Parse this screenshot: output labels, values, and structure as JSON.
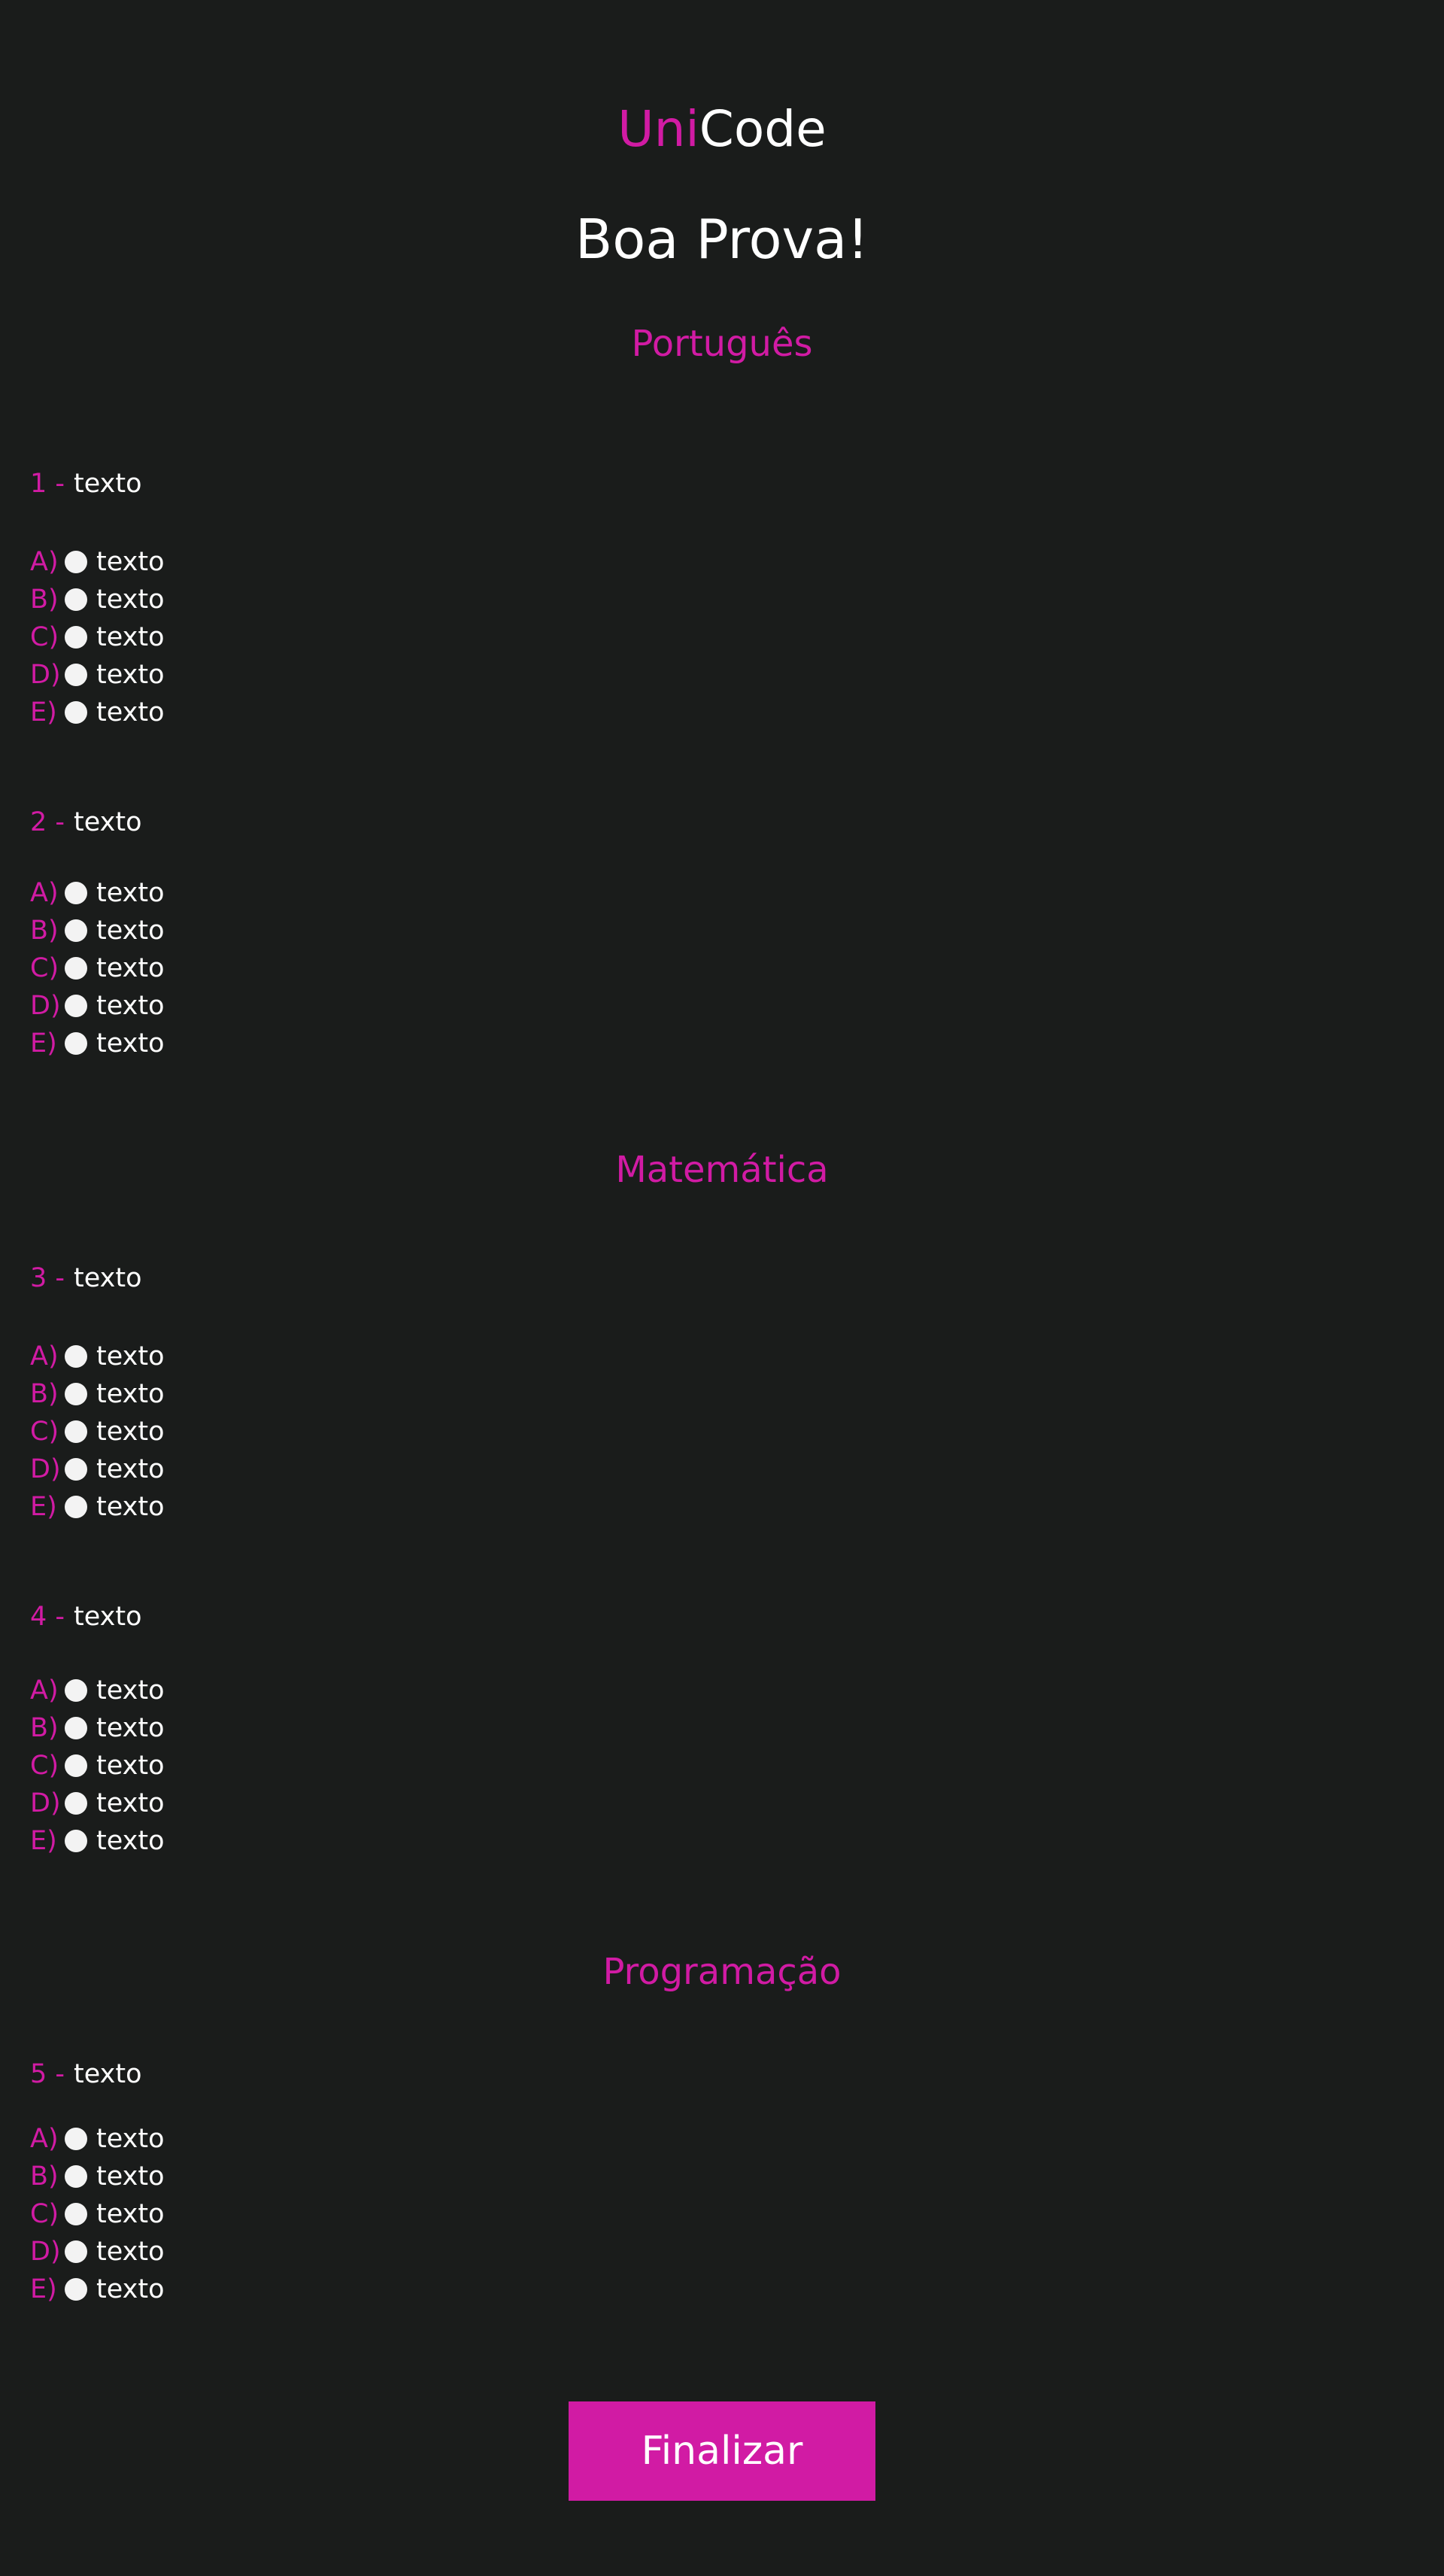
{
  "header": {
    "logo_part1": "Uni",
    "logo_part2": "Code",
    "title": "Boa Prova!"
  },
  "sections": [
    {
      "title": "Português"
    },
    {
      "title": "Matemática"
    },
    {
      "title": "Programação"
    }
  ],
  "questions": [
    {
      "number": "1 -",
      "text": "texto",
      "options": [
        {
          "letter": "A)",
          "text": "texto"
        },
        {
          "letter": "B)",
          "text": "texto"
        },
        {
          "letter": "C)",
          "text": "texto"
        },
        {
          "letter": "D)",
          "text": "texto"
        },
        {
          "letter": "E)",
          "text": "texto"
        }
      ]
    },
    {
      "number": "2 -",
      "text": "texto",
      "options": [
        {
          "letter": "A)",
          "text": "texto"
        },
        {
          "letter": "B)",
          "text": "texto"
        },
        {
          "letter": "C)",
          "text": "texto"
        },
        {
          "letter": "D)",
          "text": "texto"
        },
        {
          "letter": "E)",
          "text": "texto"
        }
      ]
    },
    {
      "number": "3 -",
      "text": "texto",
      "options": [
        {
          "letter": "A)",
          "text": "texto"
        },
        {
          "letter": "B)",
          "text": "texto"
        },
        {
          "letter": "C)",
          "text": "texto"
        },
        {
          "letter": "D)",
          "text": "texto"
        },
        {
          "letter": "E)",
          "text": "texto"
        }
      ]
    },
    {
      "number": "4 -",
      "text": "texto",
      "options": [
        {
          "letter": "A)",
          "text": "texto"
        },
        {
          "letter": "B)",
          "text": "texto"
        },
        {
          "letter": "C)",
          "text": "texto"
        },
        {
          "letter": "D)",
          "text": "texto"
        },
        {
          "letter": "E)",
          "text": "texto"
        }
      ]
    },
    {
      "number": "5 -",
      "text": "texto",
      "options": [
        {
          "letter": "A)",
          "text": "texto"
        },
        {
          "letter": "B)",
          "text": "texto"
        },
        {
          "letter": "C)",
          "text": "texto"
        },
        {
          "letter": "D)",
          "text": "texto"
        },
        {
          "letter": "E)",
          "text": "texto"
        }
      ]
    }
  ],
  "footer": {
    "finish_label": "Finalizar"
  },
  "colors": {
    "background": "#1a1c1b",
    "accent": "#d11ba4",
    "text": "#ffffff",
    "radio": "#f3f3f3"
  }
}
